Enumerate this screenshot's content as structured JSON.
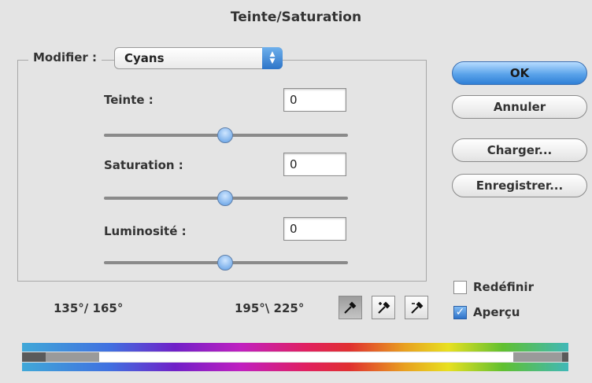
{
  "window": {
    "title": "Teinte/Saturation"
  },
  "modifier": {
    "label": "Modifier :",
    "selected": "Cyans"
  },
  "adjustments": [
    {
      "label": "Teinte :",
      "value": "0",
      "slider_fraction": 0.5
    },
    {
      "label": "Saturation :",
      "value": "0",
      "slider_fraction": 0.5
    },
    {
      "label": "Luminosité :",
      "value": "0",
      "slider_fraction": 0.5
    }
  ],
  "buttons": {
    "ok": "OK",
    "cancel": "Annuler",
    "load": "Charger...",
    "save": "Enregistrer..."
  },
  "ranges": {
    "left": "135°/ 165°",
    "right": "195°\\ 225°"
  },
  "tools": [
    "eyedropper-icon",
    "eyedropper-plus-icon",
    "eyedropper-minus-icon"
  ],
  "options": {
    "colorize": {
      "label": "Redéfinir",
      "checked": false
    },
    "preview": {
      "label": "Aperçu",
      "checked": true
    }
  },
  "colors": {
    "accent": "#2f7fd6"
  }
}
